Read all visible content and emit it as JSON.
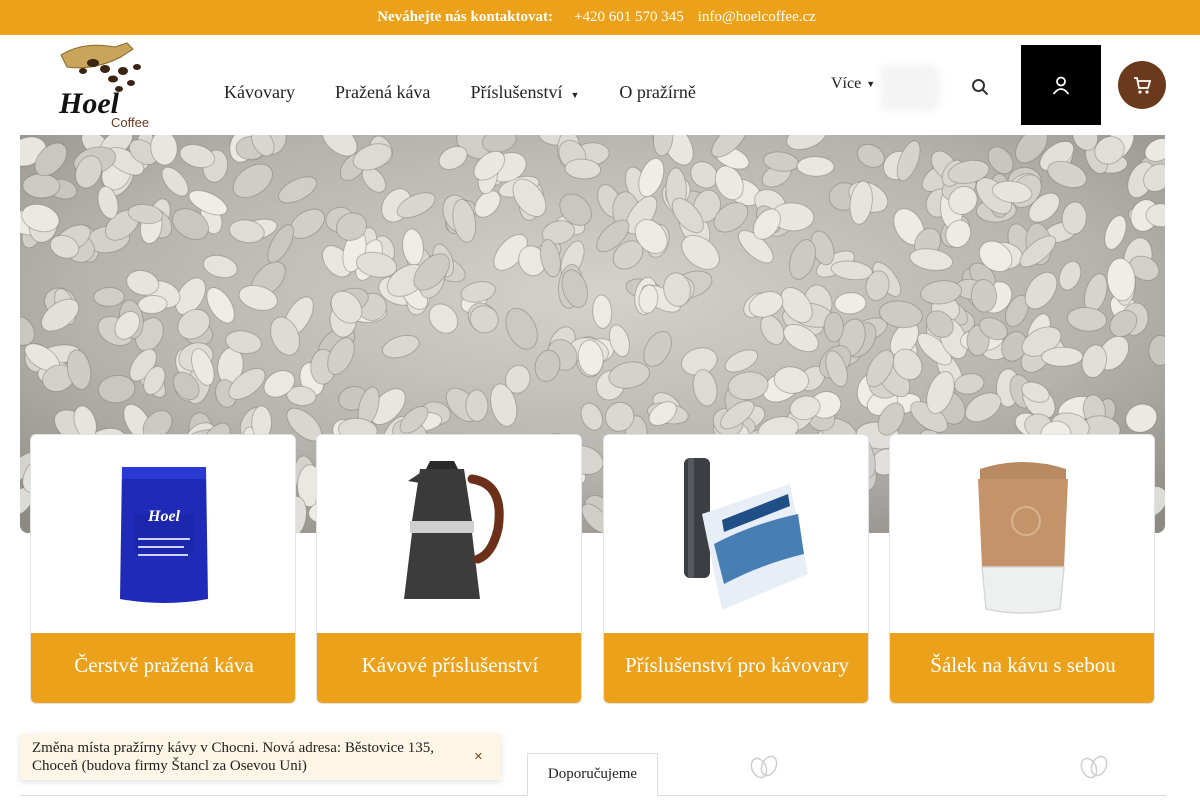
{
  "topbar": {
    "label": "Neváhejte nás kontaktovat:",
    "phone": "+420 601 570 345",
    "email": "info@hoelcoffee.cz"
  },
  "logo": {
    "brand": "Hoel",
    "sub": "Coffee"
  },
  "nav": {
    "items": [
      {
        "label": "Kávovary"
      },
      {
        "label": "Pražená káva"
      },
      {
        "label": "Příslušenství",
        "has_dropdown": true
      },
      {
        "label": "O pražírně"
      }
    ],
    "more_label": "Více"
  },
  "header_icons": {
    "search": "search-icon",
    "account": "user-icon",
    "cart": "cart-icon"
  },
  "categories": [
    {
      "label": "Čerstvě pražená káva",
      "icon": "coffee-bag-icon"
    },
    {
      "label": "Kávové příslušenství",
      "icon": "moka-pot-icon"
    },
    {
      "label": "Příslušenství pro kávovary",
      "icon": "water-filter-icon"
    },
    {
      "label": "Šálek na kávu s sebou",
      "icon": "travel-cup-icon"
    }
  ],
  "tabs": {
    "active_label": "Doporučujeme"
  },
  "notice": {
    "text": "Změna místa pražírny kávy v Chocni. Nová adresa: Běstovice 135, Choceň (budova firmy Štancl za Osevou Uni)"
  },
  "colors": {
    "accent": "#eba21a",
    "brown": "#6b3a1c",
    "black": "#000000"
  }
}
